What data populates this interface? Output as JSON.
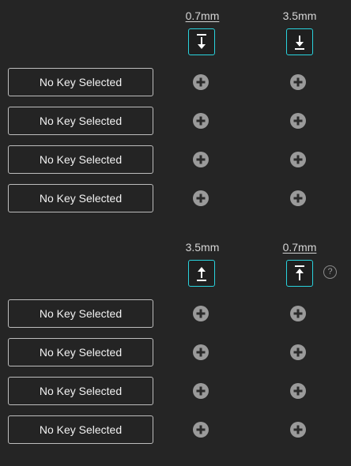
{
  "upper": {
    "col1_label": "0.7mm",
    "col2_label": "3.5mm",
    "col1_icon": "press-actuation-icon",
    "col2_icon": "press-bottom-out-icon",
    "rows": [
      {
        "label": "No Key Selected"
      },
      {
        "label": "No Key Selected"
      },
      {
        "label": "No Key Selected"
      },
      {
        "label": "No Key Selected"
      }
    ]
  },
  "lower": {
    "col1_label": "3.5mm",
    "col2_label": "0.7mm",
    "col1_icon": "release-bottom-icon",
    "col2_icon": "release-top-icon",
    "help_glyph": "?",
    "rows": [
      {
        "label": "No Key Selected"
      },
      {
        "label": "No Key Selected"
      },
      {
        "label": "No Key Selected"
      },
      {
        "label": "No Key Selected"
      }
    ]
  },
  "colors": {
    "background": "#252525",
    "accent": "#29d3de",
    "border": "#bdbdbd",
    "plus": "#9a9a9a"
  }
}
